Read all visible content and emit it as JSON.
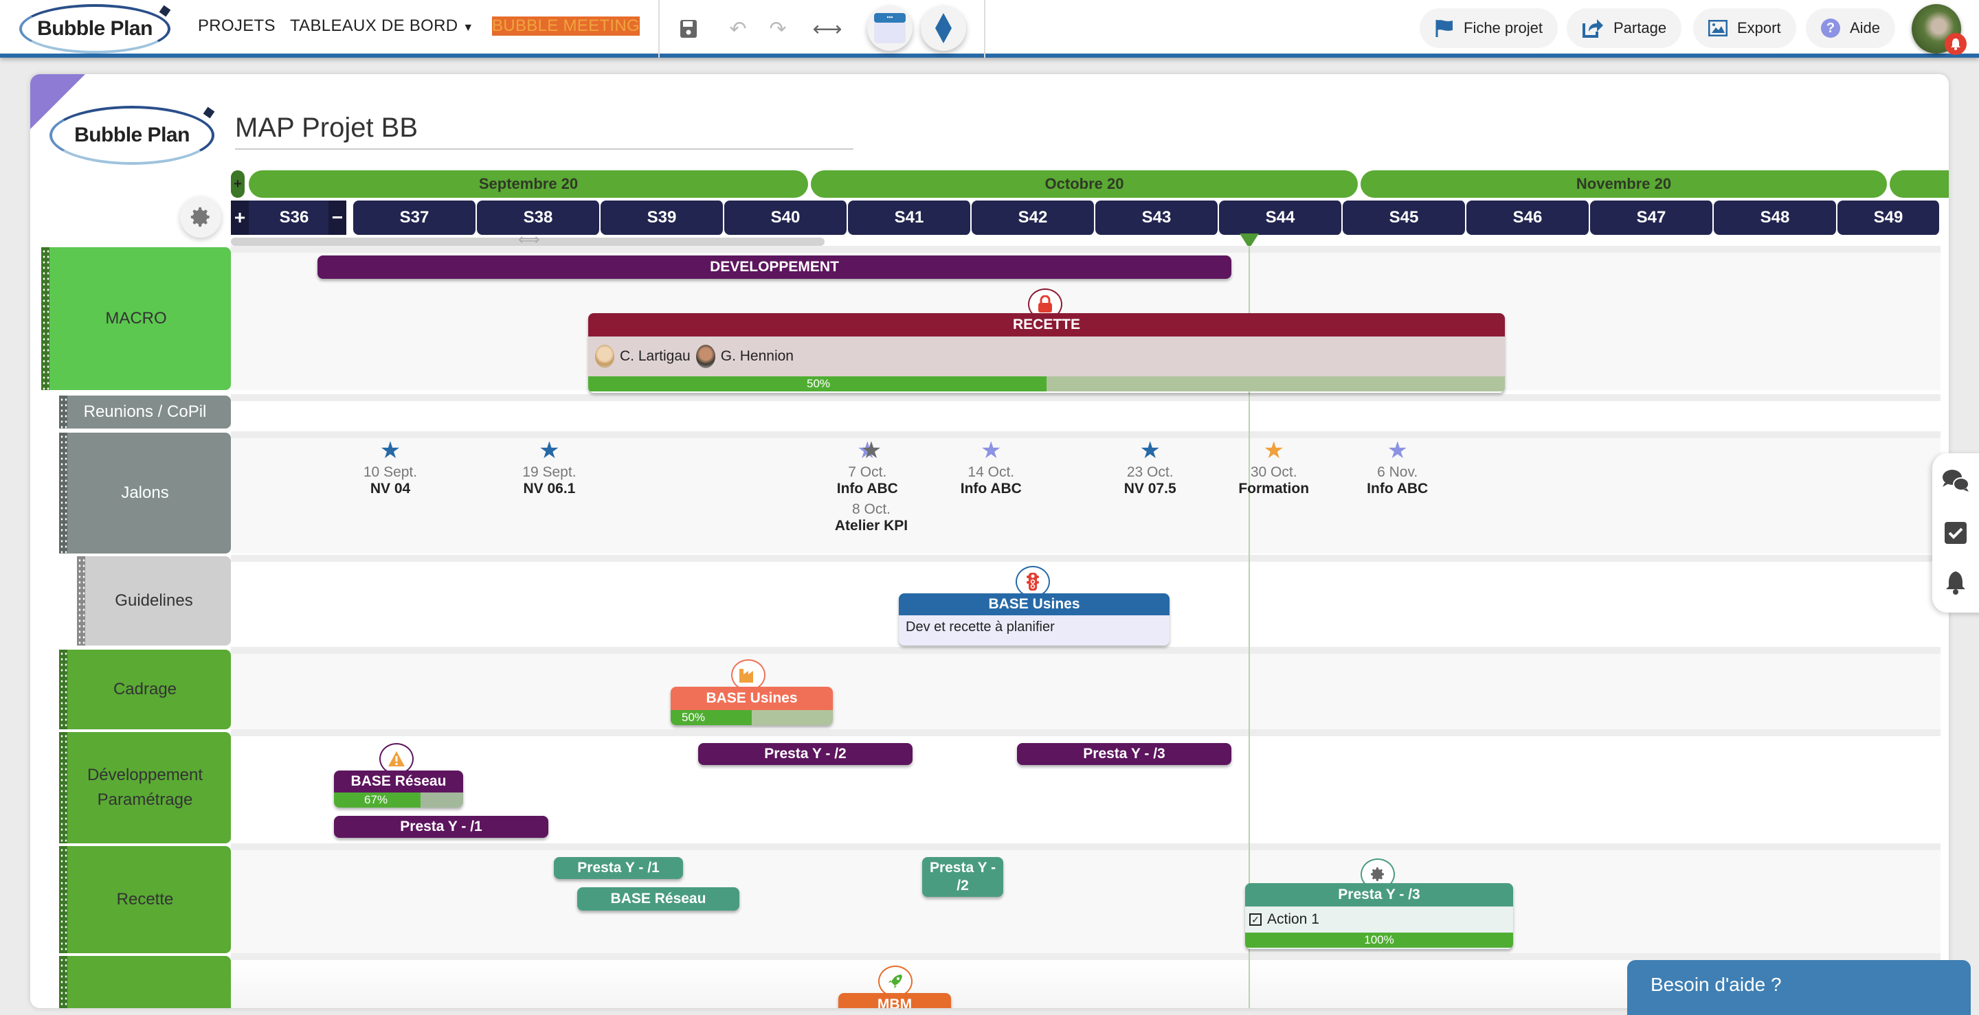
{
  "topbar": {
    "logo": "Bubble Plan",
    "nav": [
      {
        "label": "PROJETS"
      },
      {
        "label": "TABLEAUX DE BORD"
      },
      {
        "label": "BUBBLE MEETING"
      }
    ],
    "toolbar_icons": [
      "save-icon",
      "undo-icon",
      "redo-icon",
      "expand-horizontal-icon",
      "calendar-view-icon",
      "milestone-diamond-icon"
    ],
    "actions": [
      {
        "label": "Fiche projet",
        "icon": "flag-icon"
      },
      {
        "label": "Partage",
        "icon": "share-icon"
      },
      {
        "label": "Export",
        "icon": "image-icon"
      },
      {
        "label": "Aide",
        "icon": "question-icon"
      }
    ],
    "accent": "#2769a6"
  },
  "project": {
    "logo": "Bubble Plan",
    "title": "MAP Projet BB"
  },
  "timeline": {
    "months": [
      "Septembre 20",
      "Octobre 20",
      "Novembre 20"
    ],
    "weeks": [
      "S36",
      "S37",
      "S38",
      "S39",
      "S40",
      "S41",
      "S42",
      "S43",
      "S44",
      "S45",
      "S46",
      "S47",
      "S48",
      "S49"
    ],
    "today_week": "S44",
    "zoom_in": "+",
    "zoom_out": "−",
    "add": "+"
  },
  "lanes": [
    {
      "label": "MACRO"
    },
    {
      "label": "Reunions / CoPil"
    },
    {
      "label": "Jalons"
    },
    {
      "label": "Guidelines"
    },
    {
      "label": "Cadrage"
    },
    {
      "label": "Développement Paramétrage"
    },
    {
      "label": "Recette"
    },
    {
      "label": ""
    }
  ],
  "macro": {
    "developpement": {
      "label": "DEVELOPPEMENT",
      "color": "#5d155e"
    },
    "recette": {
      "label": "RECETTE",
      "color": "#8c1a34",
      "badge": "lock-icon",
      "people": [
        "C. Lartigau",
        "G. Hennion"
      ],
      "progress_label": "50%",
      "progress": 0.5
    }
  },
  "milestones": [
    {
      "date": "10 Sept.",
      "name": "NV 04",
      "color": "#2769a6"
    },
    {
      "date": "19 Sept.",
      "name": "NV 06.1",
      "color": "#2769a6"
    },
    {
      "date": "7 Oct.",
      "name": "Info ABC",
      "color": "#8c93e3"
    },
    {
      "date": "8 Oct.",
      "name": "Atelier KPI",
      "color": "#6b6b6b"
    },
    {
      "date": "14 Oct.",
      "name": "Info ABC",
      "color": "#8c93e3"
    },
    {
      "date": "23 Oct.",
      "name": "NV 07.5",
      "color": "#2769a6"
    },
    {
      "date": "30 Oct.",
      "name": "Formation",
      "color": "#f0a03c"
    },
    {
      "date": "6 Nov.",
      "name": "Info ABC",
      "color": "#8c93e3"
    }
  ],
  "guidelines": {
    "title": "BASE Usines",
    "note": "Dev et recette à planifier",
    "badge": "traffic-light-icon"
  },
  "cadrage": {
    "title": "BASE Usines",
    "badge": "factory-icon",
    "progress_label": "50%",
    "progress": 0.5
  },
  "dev": {
    "base_reseau": {
      "title": "BASE Réseau",
      "badge": "warning-icon",
      "progress_label": "67%",
      "progress": 0.67
    },
    "bars": [
      "Presta Y - /1",
      "Presta Y - /2",
      "Presta Y - /3"
    ]
  },
  "recette_lane": {
    "presta1": "Presta Y - /1",
    "base_reseau": "BASE Réseau",
    "presta2": "Presta Y - /2",
    "presta3": {
      "title": "Presta Y - /3",
      "badge": "gear-icon",
      "action": "Action 1",
      "progress_label": "100%",
      "progress": 1.0
    }
  },
  "next_lane": {
    "title": "MBM",
    "badge": "rocket-icon"
  },
  "side_panel": [
    "comments-icon",
    "checkbox-icon",
    "bell-icon"
  ],
  "help": {
    "label": "Besoin d'aide ?"
  }
}
